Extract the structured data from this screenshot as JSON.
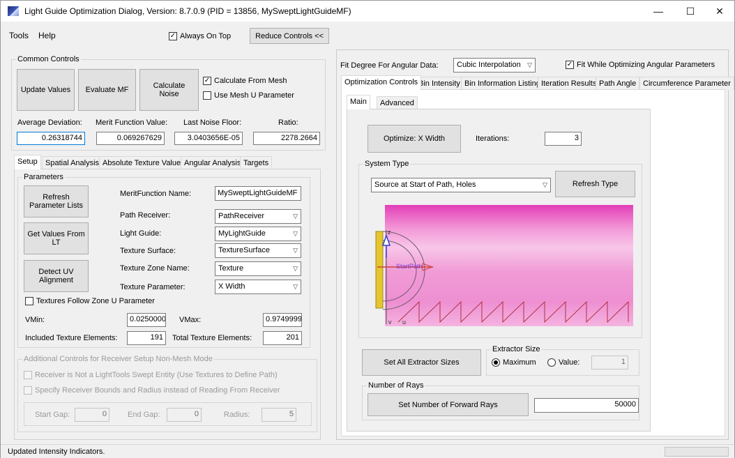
{
  "window": {
    "title": "Light Guide Optimization Dialog, Version: 8.7.0.9 (PID = 13856, MySweptLightGuideMF)",
    "minimize": "—",
    "maximize": "☐",
    "close": "✕"
  },
  "menu": {
    "tools": "Tools",
    "help": "Help",
    "always_on_top": "Always On Top",
    "always_on_top_checked": true,
    "reduce_controls": "Reduce Controls <<"
  },
  "common": {
    "title": "Common Controls",
    "update_values": "Update Values",
    "evaluate_mf": "Evaluate MF",
    "calculate_noise": "Calculate Noise",
    "calc_from_mesh": "Calculate From Mesh",
    "use_mesh_u": "Use Mesh U Parameter",
    "avg_dev_label": "Average Deviation:",
    "avg_dev": "0.26318744",
    "mf_label": "Merit Function Value:",
    "mf": "0.069267629",
    "noise_label": "Last Noise Floor:",
    "noise": "3.0403656E-05",
    "ratio_label": "Ratio:",
    "ratio": "2278.2664"
  },
  "left_tabs": [
    "Setup",
    "Spatial Analysis",
    "Absolute Texture Value",
    "Angular Analysis",
    "Targets"
  ],
  "params": {
    "title": "Parameters",
    "refresh": "Refresh Parameter Lists",
    "get_values": "Get Values From LT",
    "detect_uv": "Detect UV Alignment",
    "mf_name_label": "MeritFunction Name:",
    "mf_name": "MySweptLightGuideMF",
    "path_receiver_label": "Path Receiver:",
    "path_receiver": "PathReceiver",
    "light_guide_label": "Light Guide:",
    "light_guide": "MyLightGuide",
    "texture_surface_label": "Texture Surface:",
    "texture_surface": "TextureSurface",
    "texture_zone_label": "Texture Zone Name:",
    "texture_zone": "Texture",
    "texture_param_label": "Texture Parameter:",
    "texture_param": "X Width",
    "follow_zone": "Textures Follow Zone U Parameter",
    "vmin_label": "VMin:",
    "vmin": "0.0250000",
    "vmax_label": "VMax:",
    "vmax": "0.9749999",
    "included_label": "Included Texture Elements:",
    "included": "191",
    "total_label": "Total Texture Elements:",
    "total": "201"
  },
  "additional": {
    "title": "Additional Controls for Receiver Setup Non-Mesh Mode",
    "not_swept": "Receiver is Not a LightTools Swept Entity (Use Textures to Define Path)",
    "specify_bounds": "Specify Receiver Bounds and Radius instead of Reading From Receiver",
    "start_gap_label": "Start Gap:",
    "start_gap": "0",
    "end_gap_label": "End Gap:",
    "end_gap": "0",
    "radius_label": "Radius:",
    "radius": "5"
  },
  "right": {
    "fit_degree_label": "Fit Degree For Angular Data:",
    "fit_degree": "Cubic Interpolation",
    "fit_while": "Fit While Optimizing Angular Parameters",
    "tabs": [
      "Optimization Controls",
      "Bin Intensity",
      "Bin Information Listing",
      "Iteration Results",
      "Path Angle",
      "Circumference Parameter"
    ],
    "subtabs": [
      "Main",
      "Advanced"
    ],
    "optimize": "Optimize: X Width",
    "iterations_label": "Iterations:",
    "iterations": "3",
    "system_type_title": "System Type",
    "system_type": "Source at Start of Path, Holes",
    "refresh_type": "Refresh Type",
    "diagram_start_label": "StartPath",
    "diagram_z": "z",
    "diagram_v": "v",
    "diagram_u": "u",
    "set_all_extractor": "Set All Extractor Sizes",
    "extractor_title": "Extractor Size",
    "maximum": "Maximum",
    "value_label": "Value:",
    "extractor_value": "1",
    "rays_title": "Number of Rays",
    "set_rays": "Set Number of Forward Rays",
    "rays": "50000"
  },
  "status": {
    "text": "Updated Intensity Indicators."
  }
}
